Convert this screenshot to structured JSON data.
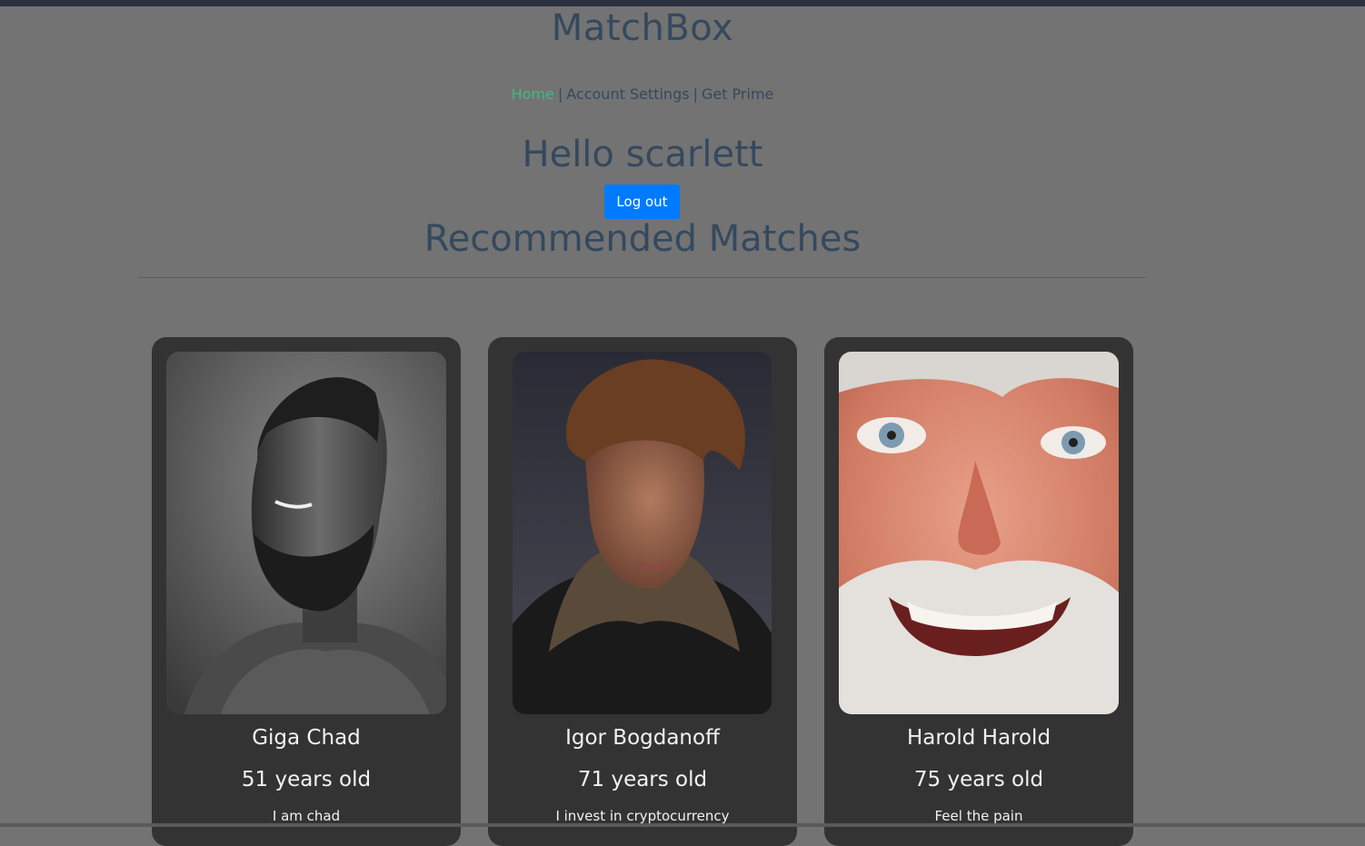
{
  "header": {
    "brand": "MatchBox"
  },
  "nav": {
    "items": [
      {
        "label": "Home",
        "active": true
      },
      {
        "label": "Account Settings",
        "active": false
      },
      {
        "label": "Get Prime",
        "active": false
      }
    ],
    "separator": "|"
  },
  "greeting": "Hello scarlett",
  "logout_label": "Log out",
  "section_title": "Recommended Matches",
  "colors": {
    "background": "#737373",
    "heading": "#34495e",
    "nav_active": "#41b883",
    "button": "#007bff",
    "card": "#333333",
    "card_text": "#f2f2f2"
  },
  "matches": [
    {
      "name": "Giga Chad",
      "age": "51 years old",
      "bio": "I am chad",
      "photo": "profile-photo-giga-chad"
    },
    {
      "name": "Igor Bogdanoff",
      "age": "71 years old",
      "bio": "I invest in cryptocurrency",
      "photo": "profile-photo-igor-bogdanoff"
    },
    {
      "name": "Harold Harold",
      "age": "75 years old",
      "bio": "Feel the pain",
      "photo": "profile-photo-harold-harold"
    }
  ]
}
